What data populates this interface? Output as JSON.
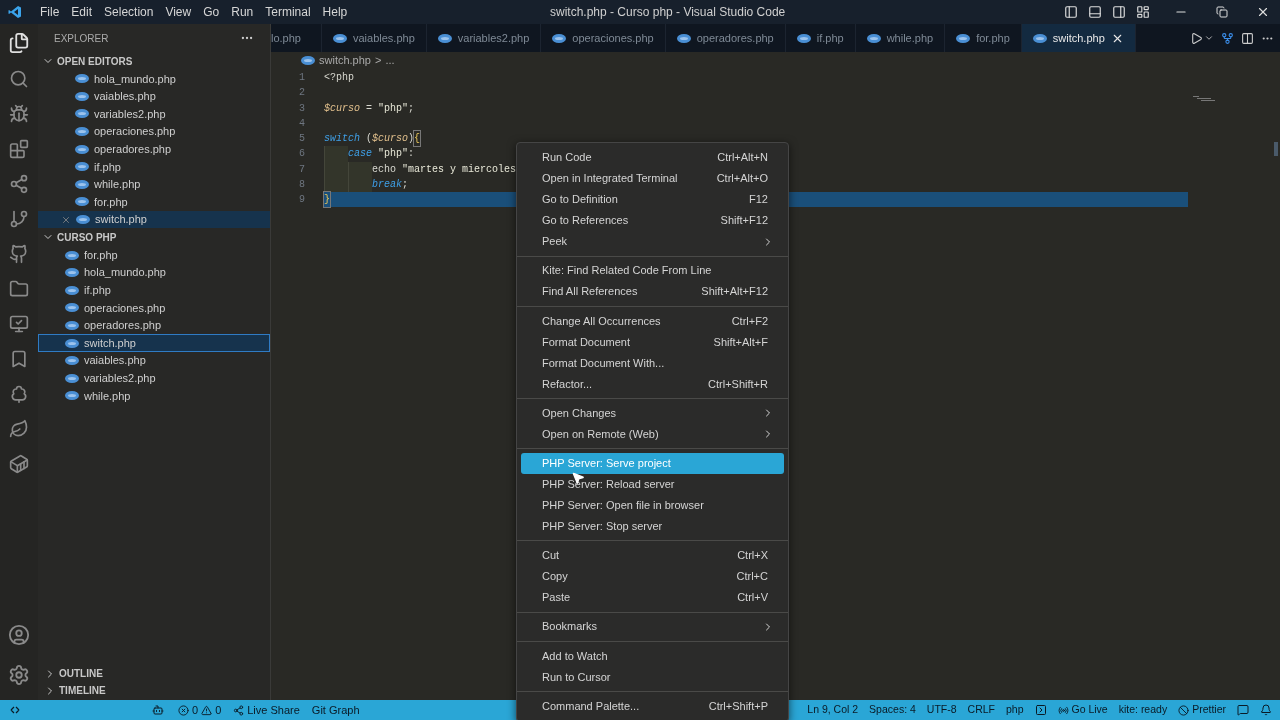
{
  "menu_bar": [
    "File",
    "Edit",
    "Selection",
    "View",
    "Go",
    "Run",
    "Terminal",
    "Help"
  ],
  "window": {
    "title": "switch.php - Curso php - Visual Studio Code"
  },
  "sidebar": {
    "title": "EXPLORER",
    "sections": [
      {
        "title": "OPEN EDITORS",
        "expanded": true,
        "items": [
          {
            "label": "hola_mundo.php",
            "selected": false
          },
          {
            "label": "vaiables.php",
            "selected": false
          },
          {
            "label": "variables2.php",
            "selected": false
          },
          {
            "label": "operaciones.php",
            "selected": false
          },
          {
            "label": "operadores.php",
            "selected": false
          },
          {
            "label": "if.php",
            "selected": false
          },
          {
            "label": "while.php",
            "selected": false
          },
          {
            "label": "for.php",
            "selected": false
          },
          {
            "label": "switch.php",
            "selected": true
          }
        ]
      },
      {
        "title": "CURSO PHP",
        "expanded": true,
        "items": [
          {
            "label": "for.php",
            "selected": false
          },
          {
            "label": "hola_mundo.php",
            "selected": false
          },
          {
            "label": "if.php",
            "selected": false
          },
          {
            "label": "operaciones.php",
            "selected": false
          },
          {
            "label": "operadores.php",
            "selected": false
          },
          {
            "label": "switch.php",
            "selected": true
          },
          {
            "label": "vaiables.php",
            "selected": false
          },
          {
            "label": "variables2.php",
            "selected": false
          },
          {
            "label": "while.php",
            "selected": false
          }
        ]
      }
    ],
    "bottom_sections": [
      {
        "title": "OUTLINE",
        "expanded": false
      },
      {
        "title": "TIMELINE",
        "expanded": false
      }
    ]
  },
  "tabs": [
    {
      "label": "lo.php",
      "icon": false,
      "selected": false
    },
    {
      "label": "vaiables.php",
      "icon": true,
      "selected": false
    },
    {
      "label": "variables2.php",
      "icon": true,
      "selected": false
    },
    {
      "label": "operaciones.php",
      "icon": true,
      "selected": false
    },
    {
      "label": "operadores.php",
      "icon": true,
      "selected": false
    },
    {
      "label": "if.php",
      "icon": true,
      "selected": false
    },
    {
      "label": "while.php",
      "icon": true,
      "selected": false
    },
    {
      "label": "for.php",
      "icon": true,
      "selected": false
    },
    {
      "label": "switch.php",
      "icon": true,
      "selected": true
    }
  ],
  "breadcrumb": {
    "file": "switch.php",
    "separator": ">",
    "rest": "..."
  },
  "editor": {
    "lines": [
      {
        "number": "1",
        "selected": false,
        "tokens": [
          {
            "kind": "plain",
            "text": "<?php"
          }
        ]
      },
      {
        "number": "2",
        "selected": false
      },
      {
        "number": "3",
        "selected": false,
        "tokens": [
          {
            "kind": "variable",
            "text": "$curso"
          },
          {
            "kind": "plain",
            "text": " = "
          },
          {
            "kind": "string",
            "text": "\"php\""
          },
          {
            "kind": "plain",
            "text": ";"
          }
        ]
      },
      {
        "number": "4",
        "selected": false
      },
      {
        "number": "5",
        "selected": false,
        "tokens": [
          {
            "kind": "keyword",
            "text": "switch"
          },
          {
            "kind": "plain",
            "text": " ("
          },
          {
            "kind": "variable",
            "text": "$curso"
          },
          {
            "kind": "plain",
            "text": ")"
          },
          {
            "kind": "bracket",
            "text": "{"
          }
        ]
      },
      {
        "number": "6",
        "selected": false,
        "tokens": [
          {
            "kind": "guide"
          },
          {
            "kind": "keyword",
            "text": "case"
          },
          {
            "kind": "string",
            "text": " \"php\""
          },
          {
            "kind": "plain",
            "text": ":"
          }
        ]
      },
      {
        "number": "7",
        "selected": false,
        "tokens": [
          {
            "kind": "guide"
          },
          {
            "kind": "guide"
          },
          {
            "kind": "plain",
            "text": "echo "
          },
          {
            "kind": "string",
            "text": "\"martes y miercoles"
          }
        ]
      },
      {
        "number": "8",
        "selected": false,
        "tokens": [
          {
            "kind": "guide"
          },
          {
            "kind": "guide"
          },
          {
            "kind": "keyword",
            "text": "break"
          },
          {
            "kind": "plain",
            "text": ";"
          }
        ]
      },
      {
        "number": "9",
        "selected": true,
        "tokens": [
          {
            "kind": "bracket",
            "text": "}"
          }
        ]
      }
    ]
  },
  "context_menu": {
    "groups": [
      [
        {
          "label": "Run Code",
          "shortcut": "Ctrl+Alt+N",
          "submenu": false,
          "selected": false
        },
        {
          "label": "Open in Integrated Terminal",
          "shortcut": "Ctrl+Alt+O",
          "submenu": false,
          "selected": false
        },
        {
          "label": "Go to Definition",
          "shortcut": "F12",
          "submenu": false,
          "selected": false
        },
        {
          "label": "Go to References",
          "shortcut": "Shift+F12",
          "submenu": false,
          "selected": false
        },
        {
          "label": "Peek",
          "submenu": true,
          "selected": false
        }
      ],
      [
        {
          "label": "Kite: Find Related Code From Line",
          "submenu": false,
          "selected": false
        },
        {
          "label": "Find All References",
          "shortcut": "Shift+Alt+F12",
          "submenu": false,
          "selected": false
        }
      ],
      [
        {
          "label": "Change All Occurrences",
          "shortcut": "Ctrl+F2",
          "submenu": false,
          "selected": false
        },
        {
          "label": "Format Document",
          "shortcut": "Shift+Alt+F",
          "submenu": false,
          "selected": false
        },
        {
          "label": "Format Document With...",
          "submenu": false,
          "selected": false
        },
        {
          "label": "Refactor...",
          "shortcut": "Ctrl+Shift+R",
          "submenu": false,
          "selected": false
        }
      ],
      [
        {
          "label": "Open Changes",
          "submenu": true,
          "selected": false
        },
        {
          "label": "Open on Remote (Web)",
          "submenu": true,
          "selected": false
        }
      ],
      [
        {
          "label": "PHP Server: Serve project",
          "submenu": false,
          "selected": true
        },
        {
          "label": "PHP Server: Reload server",
          "submenu": false,
          "selected": false
        },
        {
          "label": "PHP Server: Open file in browser",
          "submenu": false,
          "selected": false
        },
        {
          "label": "PHP Server: Stop server",
          "submenu": false,
          "selected": false
        }
      ],
      [
        {
          "label": "Cut",
          "shortcut": "Ctrl+X",
          "submenu": false,
          "selected": false
        },
        {
          "label": "Copy",
          "shortcut": "Ctrl+C",
          "submenu": false,
          "selected": false
        },
        {
          "label": "Paste",
          "shortcut": "Ctrl+V",
          "submenu": false,
          "selected": false
        }
      ],
      [
        {
          "label": "Bookmarks",
          "submenu": true,
          "selected": false
        }
      ],
      [
        {
          "label": "Add to Watch",
          "submenu": false,
          "selected": false
        },
        {
          "label": "Run to Cursor",
          "submenu": false,
          "selected": false
        }
      ],
      [
        {
          "label": "Command Palette...",
          "shortcut": "Ctrl+Shift+P",
          "submenu": false,
          "selected": false
        }
      ]
    ]
  },
  "status_bar": {
    "errors": "0",
    "warnings": "0",
    "left": [
      "Live Share",
      "Git Graph"
    ],
    "right": [
      "Ln 9, Col 2",
      "Spaces: 4",
      "UTF-8",
      "CRLF",
      "php"
    ],
    "go_live": "Go Live",
    "kite": "kite: ready",
    "prettier": "Prettier"
  }
}
